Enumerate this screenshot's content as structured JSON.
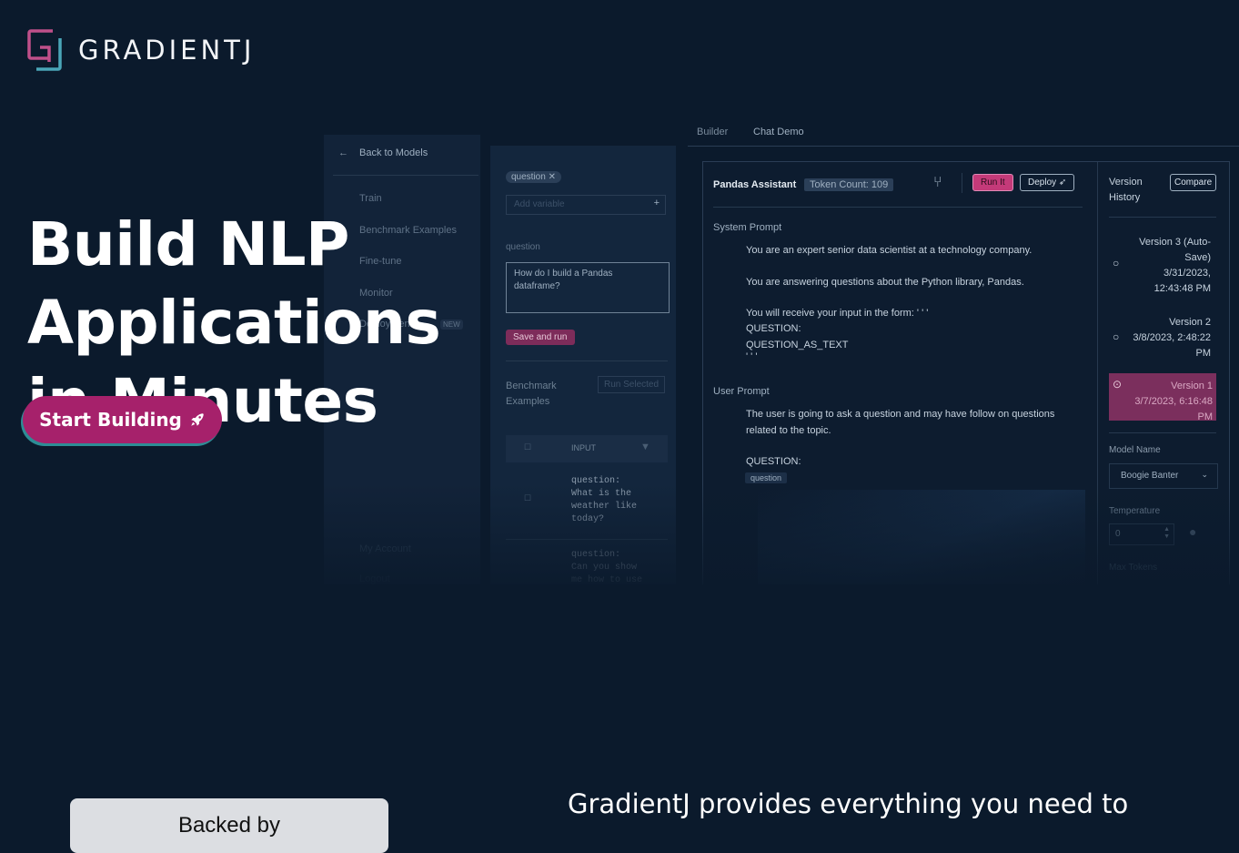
{
  "brand": {
    "name": "GRADIENTJ"
  },
  "hero": {
    "line1": "Build NLP Applications",
    "line2": "in Minutes",
    "cta_label": "Start Building"
  },
  "mockup": {
    "tabs": [
      "Builder",
      "Chat Demo"
    ],
    "sidebar": {
      "back": "Back to Models",
      "items": [
        "Train",
        "Benchmark Examples",
        "Fine-tune",
        "Monitor",
        "Deployment"
      ],
      "new_badge": "NEW",
      "footer": [
        "My Account",
        "Logout"
      ]
    },
    "variables": {
      "chip": "question",
      "add_placeholder": "Add variable",
      "question_label": "question",
      "question_value": "How do I build a Pandas dataframe?",
      "save_run": "Save and run",
      "benchmark_title": "Benchmark Examples",
      "run_selected": "Run Selected",
      "table_header": "INPUT",
      "rows": [
        "question:\nWhat is the\nweather like\ntoday?",
        "question:\nCan you show\nme how to use"
      ]
    },
    "main": {
      "title": "Pandas Assistant",
      "token_count": "Token Count: 109",
      "run_it": "Run It",
      "deploy": "Deploy",
      "system_prompt_label": "System Prompt",
      "system_lines": [
        "You are an expert senior data scientist at a technology company.",
        "You are answering questions about the Python library, Pandas.",
        "You will receive your input in the form: ' ' '",
        "QUESTION:",
        "QUESTION_AS_TEXT",
        "' ' '"
      ],
      "user_prompt_label": "User Prompt",
      "user_lines": [
        "The user is going to ask a question and may have follow on questions",
        "related to the topic.",
        "QUESTION:"
      ],
      "user_var": "question"
    },
    "history": {
      "title_line1": "Version",
      "title_line2": "History",
      "compare": "Compare",
      "versions": [
        {
          "name": "Version 3 (Auto-Save)",
          "date": "3/31/2023, 12:43:48 PM"
        },
        {
          "name": "Version 2",
          "date": "3/8/2023, 2:48:22 PM"
        },
        {
          "name": "Version 1",
          "date": "3/7/2023, 6:16:48 PM"
        }
      ],
      "model_name_label": "Model Name",
      "model_name_value": "Boogie Banter",
      "temperature_label": "Temperature",
      "temperature_value": "0",
      "max_tokens_label": "Max Tokens"
    }
  },
  "bottom": {
    "backed_by": "Backed by",
    "blurb": "GradientJ provides everything you need to"
  },
  "colors": {
    "background": "#0b1a2c",
    "cta": "#a6216b",
    "cta_shadow": "#2d8d96",
    "accent_pink": "#c43a79"
  }
}
